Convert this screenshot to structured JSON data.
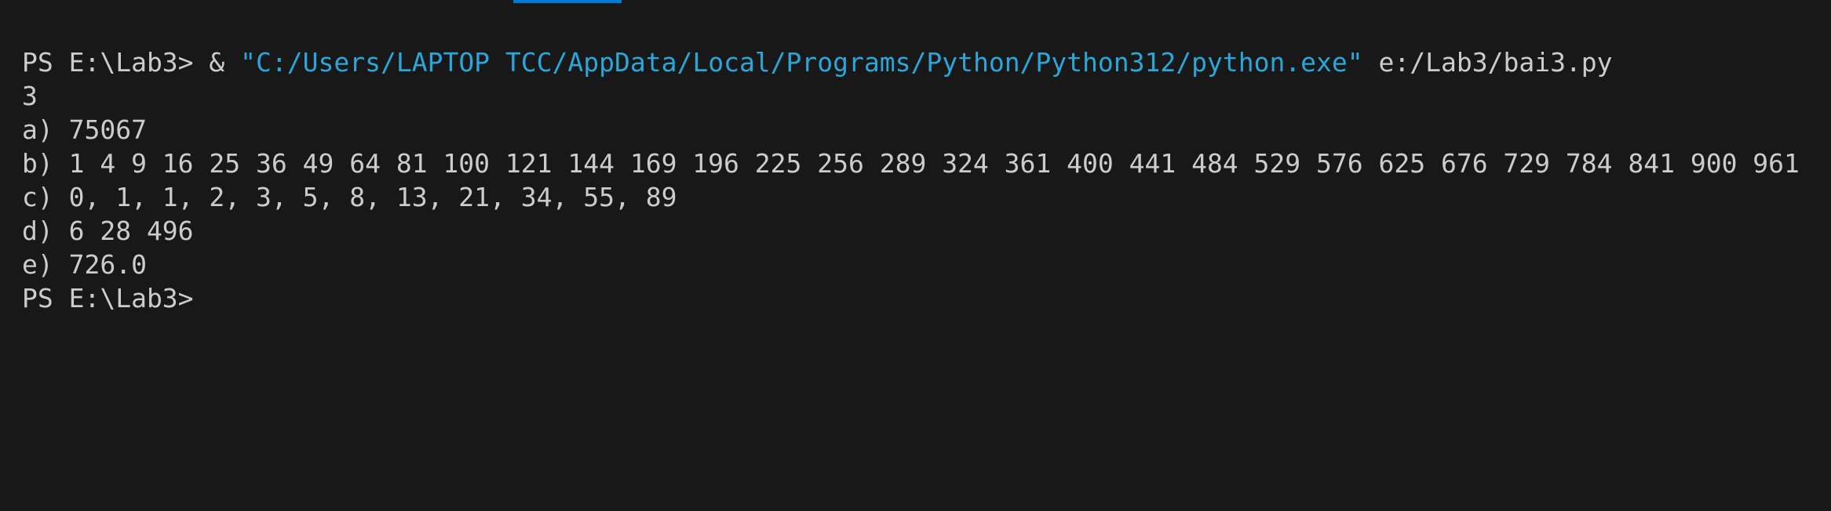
{
  "terminal": {
    "command_line": {
      "prompt": "PS E:\\Lab3> ",
      "operator": "& ",
      "exe_path": "\"C:/Users/LAPTOP TCC/AppData/Local/Programs/Python/Python312/python.exe\"",
      "script_arg": " e:/Lab3/bai3.py"
    },
    "output_lines": [
      "3",
      "a) 75067",
      "b) 1 4 9 16 25 36 49 64 81 100 121 144 169 196 225 256 289 324 361 400 441 484 529 576 625 676 729 784 841 900 961",
      "c) 0, 1, 1, 2, 3, 5, 8, 13, 21, 34, 55, 89",
      "d) 6 28 496",
      "e) 726.0"
    ],
    "final_prompt": "PS E:\\Lab3>"
  },
  "colors": {
    "background": "#181818",
    "text": "#cccccc",
    "string": "#2aa6d8",
    "tab_indicator": "#0078d4"
  }
}
